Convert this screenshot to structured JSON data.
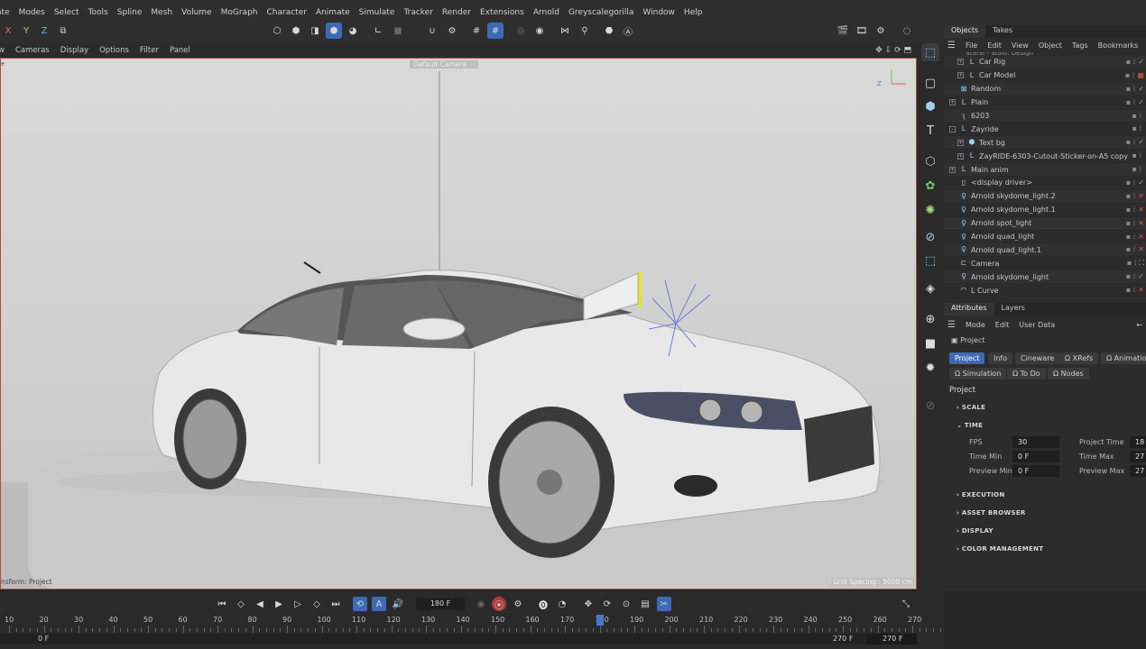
{
  "menubar": [
    "ate",
    "Modes",
    "Select",
    "Tools",
    "Spline",
    "Mesh",
    "Volume",
    "MoGraph",
    "Character",
    "Animate",
    "Simulate",
    "Tracker",
    "Render",
    "Extensions",
    "Arnold",
    "Greyscalegorilla",
    "Window",
    "Help"
  ],
  "coords": {
    "x": "X",
    "y": "Y",
    "z": "Z"
  },
  "viewport_menu": [
    "w",
    "Cameras",
    "Display",
    "Options",
    "Filter",
    "Panel"
  ],
  "viewport": {
    "camera_label": "Default Camera",
    "camera_glyph": "⁘",
    "left_text": "e",
    "status_left": "nsform: Project",
    "grid_spacing": "Grid Spacing : 5000 cm"
  },
  "objects_panel": {
    "tabs": [
      "Objects",
      "Takes"
    ],
    "menu": [
      "File",
      "Edit",
      "View",
      "Object",
      "Tags",
      "Bookmarks"
    ],
    "top_partial": "Scene - Stdio: Design",
    "items": [
      {
        "label": "Car Rig",
        "icon": "null-icon",
        "indent": 1,
        "expand": "+",
        "flag": "check"
      },
      {
        "label": "Car Model",
        "icon": "null-icon",
        "indent": 1,
        "expand": "+",
        "flag": "tag"
      },
      {
        "label": "Random",
        "icon": "effector-icon",
        "indent": 0,
        "expand": "",
        "flag": "check"
      },
      {
        "label": "Plain",
        "icon": "null-icon",
        "indent": 0,
        "expand": "+",
        "flag": "check"
      },
      {
        "label": "6203",
        "icon": "spline-icon",
        "indent": 0,
        "expand": "",
        "flag": "none"
      },
      {
        "label": "Zayride",
        "icon": "null-icon",
        "indent": 0,
        "expand": "-",
        "flag": "none"
      },
      {
        "label": "Text bg",
        "icon": "cube-icon",
        "indent": 1,
        "expand": "+",
        "flag": "check"
      },
      {
        "label": "ZayRIDE-6303-Cutout-Sticker-on-A5 copy",
        "icon": "null-icon",
        "indent": 1,
        "expand": "+",
        "flag": "none"
      },
      {
        "label": "Main anim",
        "icon": "null-icon",
        "indent": 0,
        "expand": "+",
        "flag": "none"
      },
      {
        "label": "<display driver>",
        "icon": "file-icon",
        "indent": 0,
        "expand": "",
        "flag": "check"
      },
      {
        "label": "Arnold skydome_light.2",
        "icon": "light-icon",
        "indent": 0,
        "expand": "",
        "flag": "x"
      },
      {
        "label": "Arnold skydome_light.1",
        "icon": "light-icon",
        "indent": 0,
        "expand": "",
        "flag": "x"
      },
      {
        "label": "Arnold spot_light",
        "icon": "light-icon",
        "indent": 0,
        "expand": "",
        "flag": "x"
      },
      {
        "label": "Arnold quad_light",
        "icon": "light-icon",
        "indent": 0,
        "expand": "",
        "flag": "x"
      },
      {
        "label": "Arnold quad_light.1",
        "icon": "light-icon",
        "indent": 0,
        "expand": "",
        "flag": "x"
      },
      {
        "label": "Camera",
        "icon": "camera-icon",
        "indent": 0,
        "expand": "",
        "flag": "target"
      },
      {
        "label": "Arnold skydome_light",
        "icon": "light-icon",
        "indent": 0,
        "expand": "",
        "flag": "check"
      },
      {
        "label": "L Curve",
        "icon": "curve-icon",
        "indent": 0,
        "expand": "",
        "flag": "x"
      }
    ]
  },
  "attributes_panel": {
    "tabs": [
      "Attributes",
      "Layers"
    ],
    "menu": [
      "Mode",
      "Edit",
      "User Data"
    ],
    "object_name": "Project",
    "buttons_row1": [
      "Project",
      "Info",
      "Cineware",
      "XRefs",
      "Animation"
    ],
    "buttons_row2": [
      "Simulation",
      "To Do",
      "Nodes"
    ],
    "section_title": "Project",
    "sections": [
      "SCALE",
      "TIME",
      "EXECUTION",
      "ASSET BROWSER",
      "DISPLAY",
      "COLOR MANAGEMENT"
    ],
    "fields": {
      "fps_label": "FPS",
      "fps": "30",
      "project_time_label": "Project Time",
      "project_time": "18",
      "time_min_label": "Time Min",
      "time_min": "0 F",
      "time_max_label": "Time Max",
      "time_max": "27",
      "preview_min_label": "Preview Min",
      "preview_min": "0 F",
      "preview_max_label": "Preview Max",
      "preview_max": "27"
    }
  },
  "timeline": {
    "current_frame": "180 F",
    "ticks": [
      "10",
      "20",
      "30",
      "40",
      "50",
      "60",
      "70",
      "80",
      "90",
      "100",
      "110",
      "120",
      "130",
      "140",
      "150",
      "160",
      "170",
      "180",
      "190",
      "200",
      "210",
      "220",
      "230",
      "240",
      "250",
      "260",
      "270"
    ],
    "start": "0 F",
    "end_a": "270 F",
    "end_b": "270 F"
  },
  "colors": {
    "accent": "#3d6ab6",
    "check": "#6cc36c",
    "error": "#e05050",
    "viewport_border": "#b04a4a"
  }
}
